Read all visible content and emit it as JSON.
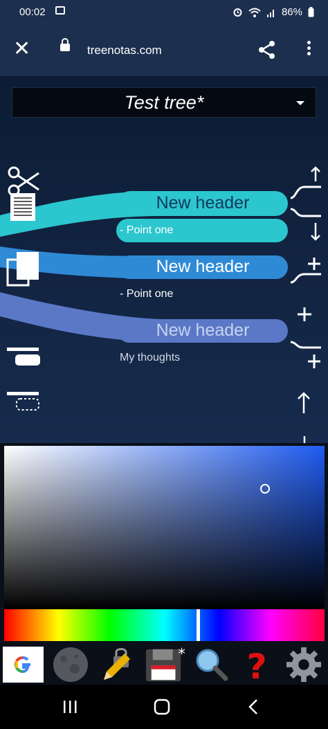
{
  "status_bar": {
    "time": "00:02",
    "battery": "86%"
  },
  "browser": {
    "url": "treenotas.com"
  },
  "app": {
    "title": "Test tree*",
    "nodes": [
      {
        "header": "New header",
        "point": "- Point one"
      },
      {
        "header": "New header",
        "point": "- Point one"
      },
      {
        "header": "New header",
        "point": "My thoughts"
      }
    ]
  },
  "colors": {
    "node1": "#2cc6cf",
    "node2": "#2f8ad6",
    "node3": "#5a78c6",
    "picker_hue": "#1e5bf0"
  }
}
